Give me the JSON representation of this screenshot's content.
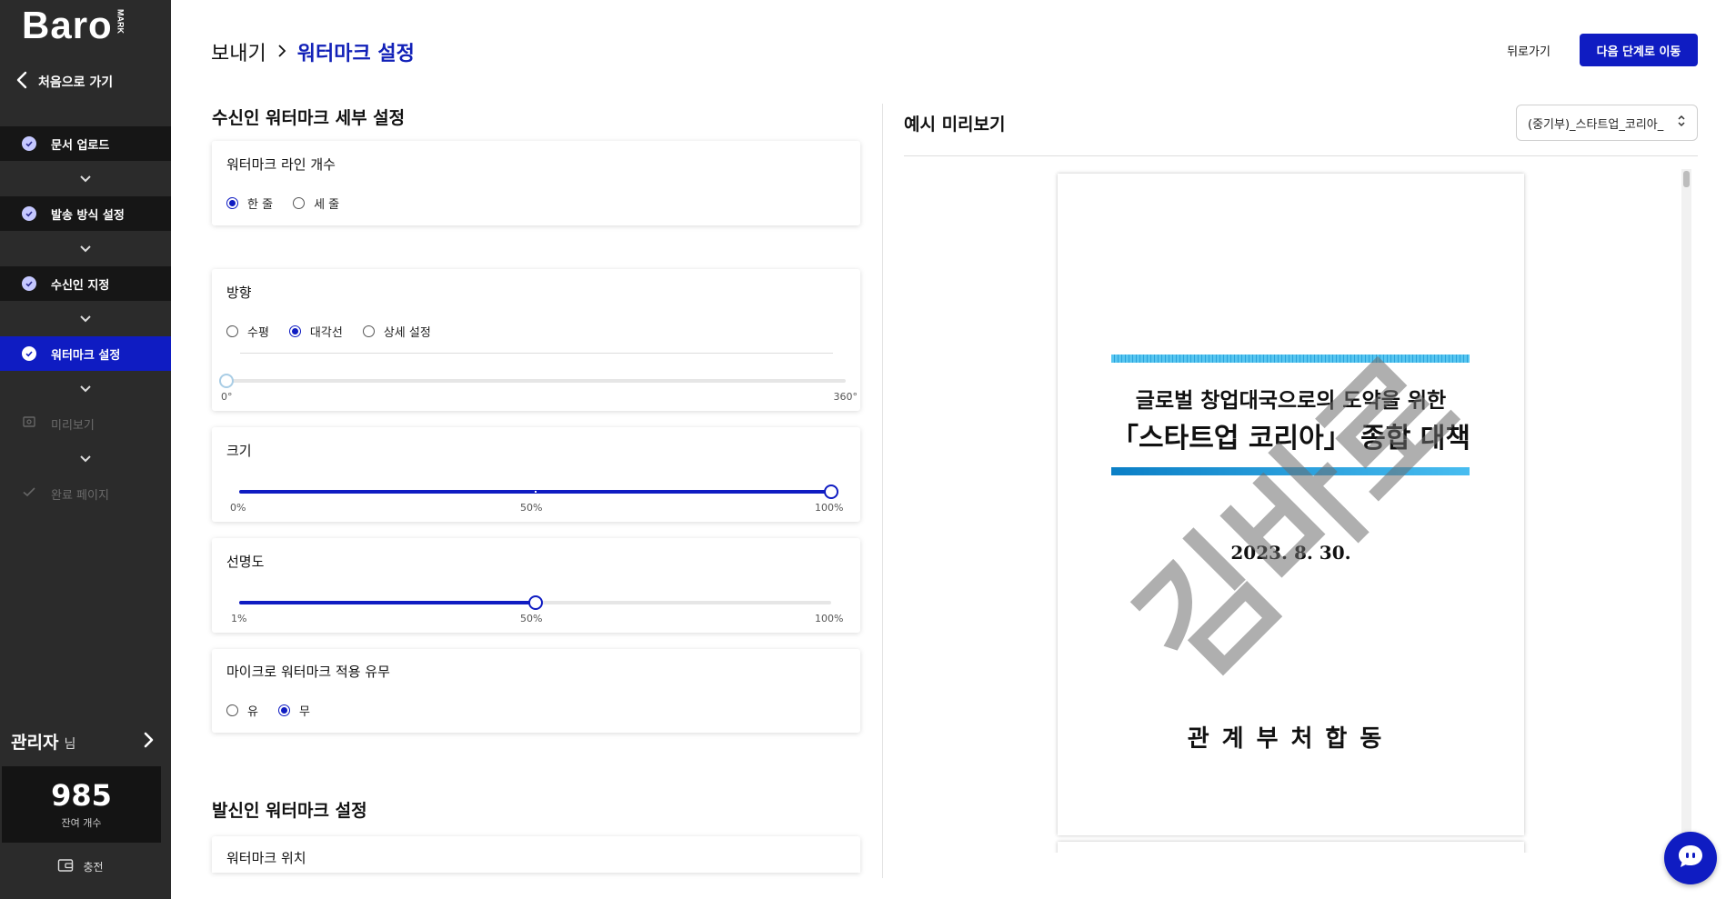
{
  "sidebar": {
    "logo": "Baro",
    "logo_sub": "MARK",
    "back_home": "처음으로 가기",
    "steps": [
      {
        "label": "문서 업로드",
        "state": "done"
      },
      {
        "label": "발송 방식 설정",
        "state": "done"
      },
      {
        "label": "수신인 지정",
        "state": "done"
      },
      {
        "label": "워터마크 설정",
        "state": "active"
      },
      {
        "label": "미리보기",
        "state": "disabled"
      },
      {
        "label": "완료 페이지",
        "state": "disabled"
      }
    ],
    "admin_name": "관리자",
    "admin_suffix": "님",
    "remaining_count": "985",
    "remaining_label": "잔여 개수",
    "charge_label": "충전"
  },
  "header": {
    "breadcrumb_parent": "보내기",
    "breadcrumb_current": "워터마크 설정",
    "back_label": "뒤로가기",
    "next_label": "다음 단계로 이동"
  },
  "recipient": {
    "section_title": "수신인 워터마크 세부 설정",
    "line_count": {
      "title": "워터마크 라인 개수",
      "options": [
        "한 줄",
        "세 줄"
      ],
      "selected": 0
    },
    "direction": {
      "title": "방향",
      "options": [
        "수평",
        "대각선",
        "상세 설정"
      ],
      "selected": 1,
      "min_label": "0°",
      "max_label": "360°",
      "value": 0
    },
    "size": {
      "title": "크기",
      "min_label": "0%",
      "mid_label": "50%",
      "max_label": "100%",
      "value_percent": 100
    },
    "clarity": {
      "title": "선명도",
      "min_label": "1%",
      "mid_label": "50%",
      "max_label": "100%",
      "value_percent": 50
    },
    "micro": {
      "title": "마이크로 워터마크 적용 유무",
      "options": [
        "유",
        "무"
      ],
      "selected": 1
    }
  },
  "sender": {
    "section_title": "발신인 워터마크 설정",
    "position_title": "워터마크 위치"
  },
  "preview": {
    "title": "예시 미리보기",
    "selected_doc": "(중기부)_스타트업_코리아_",
    "doc_line1": "글로벌 창업대국으로의 도약을 위한",
    "doc_line2": "「스타트업 코리아」 종합 대책",
    "doc_date": "2023. 8. 30.",
    "doc_org": "관계부처합동",
    "watermark_text": "김바로"
  },
  "colors": {
    "accent": "#0f1cc2",
    "sidebar_bg": "#2b2b2b",
    "sidebar_step_bg": "#161616"
  }
}
